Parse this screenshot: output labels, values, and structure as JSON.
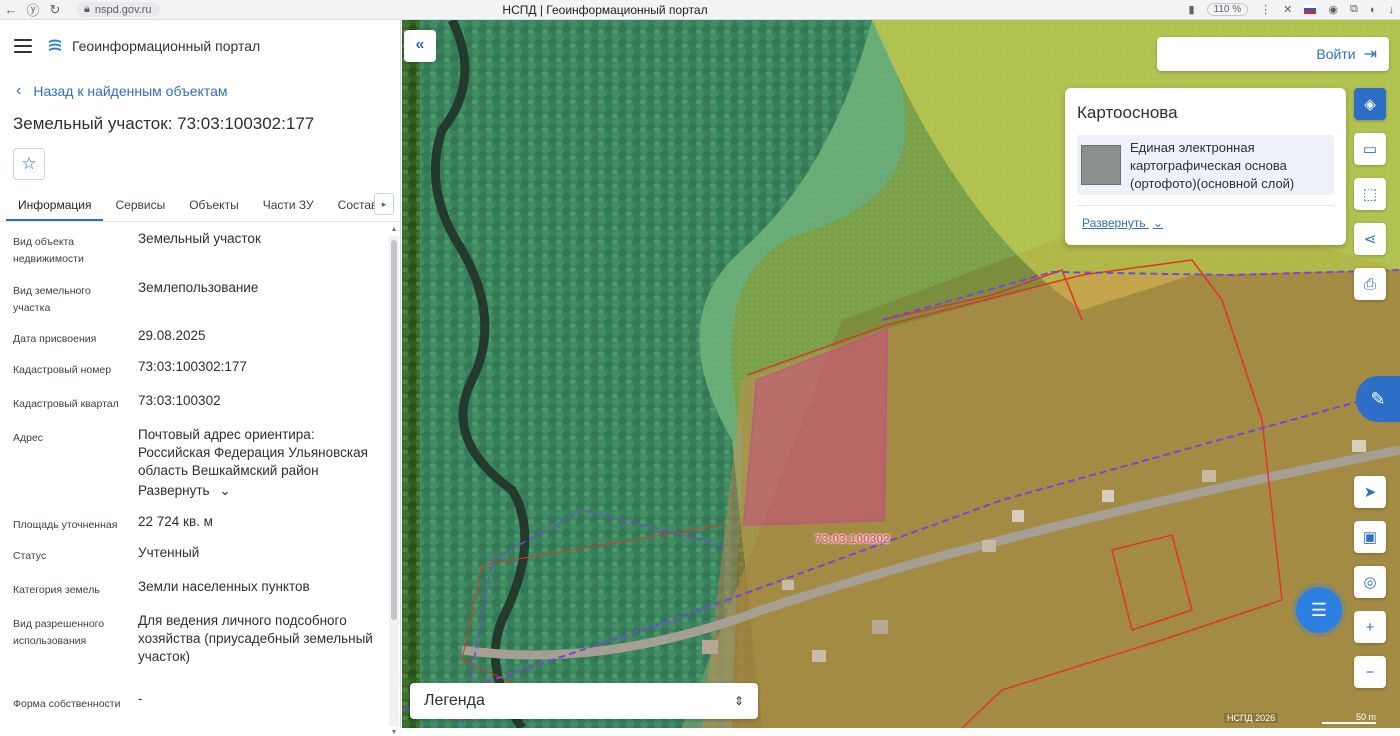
{
  "browser": {
    "url": "nspd.gov.ru",
    "tab_title": "НСПД | Геоинформационный портал",
    "zoom": "110 %"
  },
  "header": {
    "portal_title": "Геоинформационный портал"
  },
  "back_link": "Назад к найденным объектам",
  "object_title": "Земельный участок: 73:03:100302:177",
  "tabs": [
    {
      "label": "Информация",
      "active": true
    },
    {
      "label": "Сервисы"
    },
    {
      "label": "Объекты"
    },
    {
      "label": "Части ЗУ"
    },
    {
      "label": "Состав"
    }
  ],
  "properties": [
    {
      "label": "Вид объекта недвижимости",
      "value": "Земельный участок"
    },
    {
      "label": "Вид земельного участка",
      "value": "Землепользование"
    },
    {
      "label": "Дата присвоения",
      "value": "29.08.2025"
    },
    {
      "label": "Кадастровый номер",
      "value": "73:03:100302:177"
    },
    {
      "label": "Кадастровый квартал",
      "value": "73:03:100302"
    },
    {
      "label": "Адрес",
      "value": "Почтовый адрес ориентира: Российская Федерация Ульяновская область Вешкаймский район",
      "expand": "Развернуть"
    },
    {
      "label": "Площадь уточненная",
      "value": "22 724 кв. м"
    },
    {
      "label": "Статус",
      "value": "Учтенный"
    },
    {
      "label": "Категория земель",
      "value": "Земли населенных пунктов"
    },
    {
      "label": "Вид разрешенного использования",
      "value": "Для ведения личного подсобного хозяйства (приусадебный земельный участок)"
    },
    {
      "label": "Форма собственности",
      "value": "-"
    }
  ],
  "map": {
    "login_label": "Войти",
    "basemap": {
      "title": "Картооснова",
      "layer_name": "Единая электронная картографическая основа (ортофото)(основной слой)",
      "expand_label": "Развернуть"
    },
    "cadastral_label": "73:03:100302",
    "legend_label": "Легенда",
    "attribution": "НСПД 2026",
    "scale_label": "50 m",
    "tools": [
      "layers-icon",
      "ruler-icon",
      "select-area-icon",
      "share-icon",
      "print-icon",
      "locate-icon",
      "minimap-icon",
      "search-location-icon",
      "zoom-in-icon",
      "zoom-out-icon"
    ],
    "colors": {
      "accent": "#2d6ec6",
      "parcel": "#cc2ea0",
      "boundary": "#e0352b"
    }
  }
}
